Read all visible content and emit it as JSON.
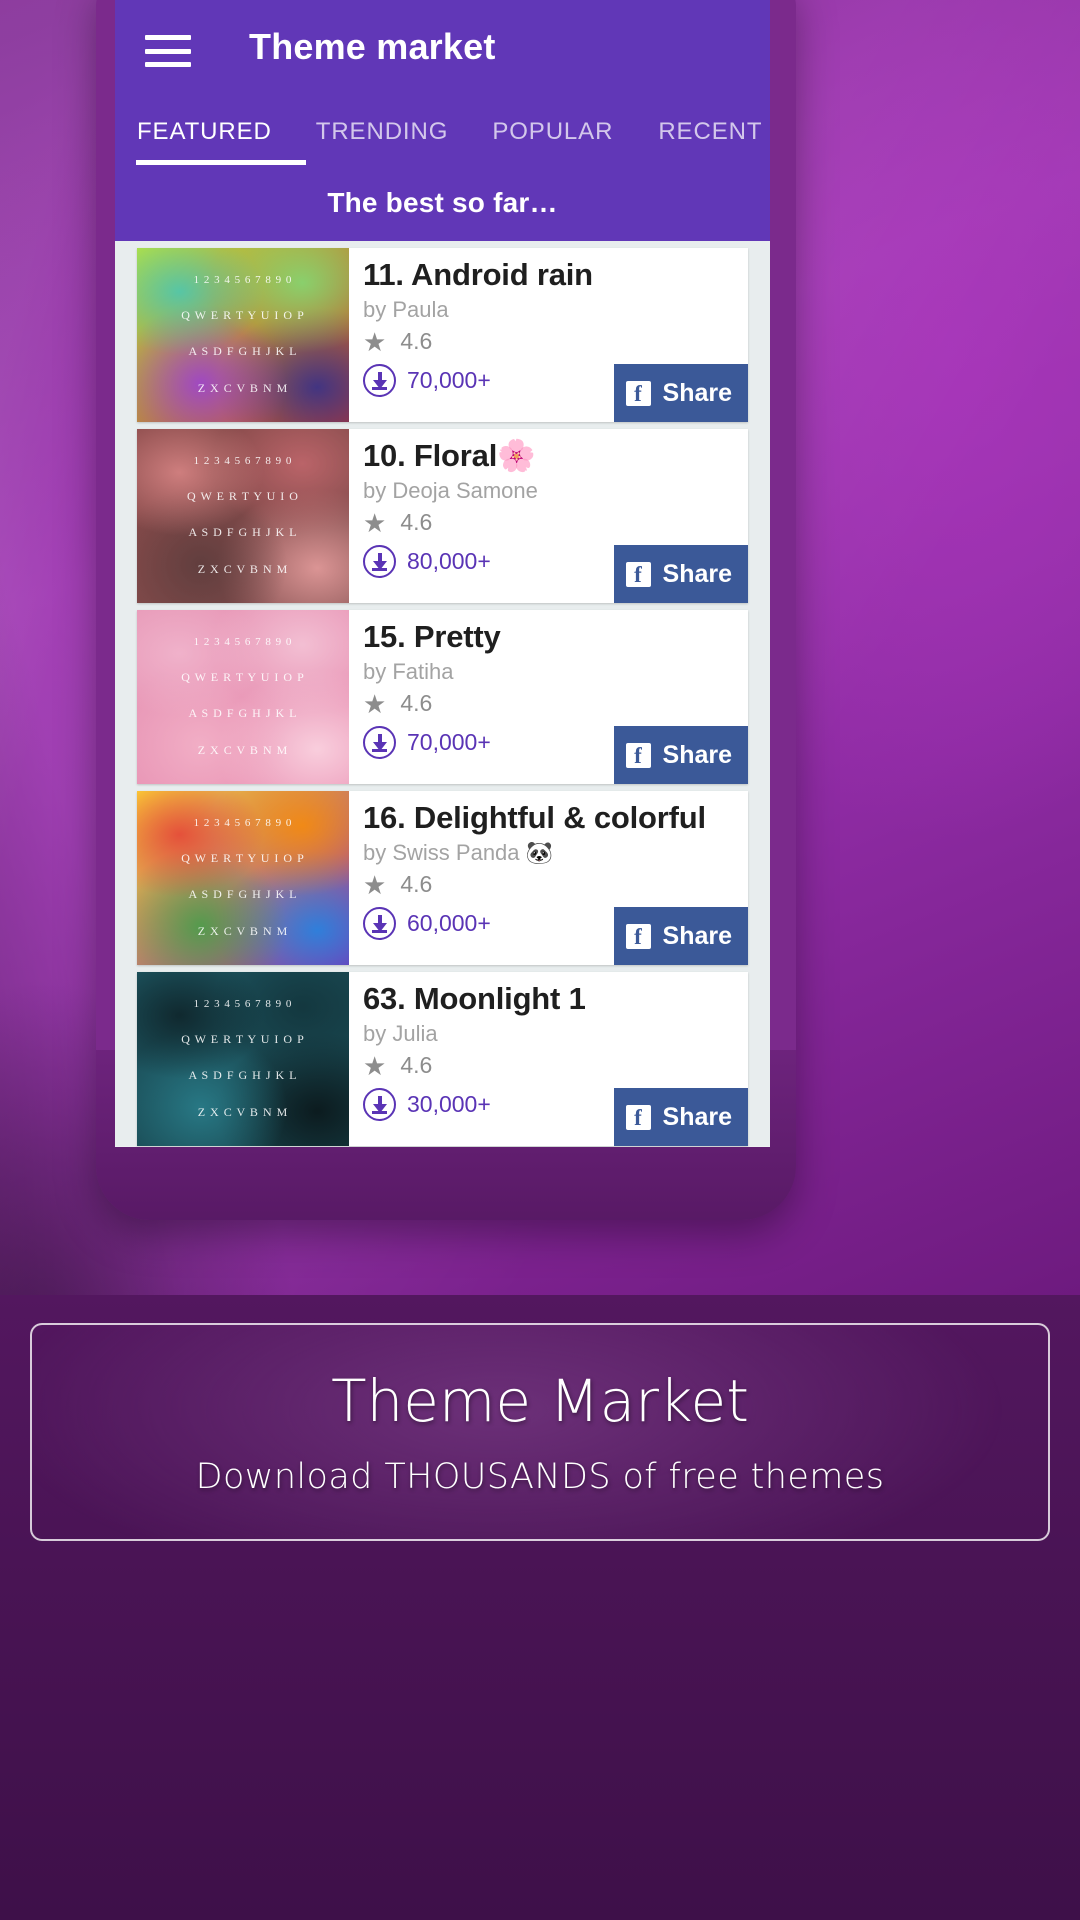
{
  "appbar": {
    "menu_icon": "hamburger-menu-icon",
    "title": "Theme market"
  },
  "tabs": [
    {
      "label": "FEATURED",
      "active": true
    },
    {
      "label": "TRENDING",
      "active": false
    },
    {
      "label": "POPULAR",
      "active": false
    },
    {
      "label": "RECENT",
      "active": false
    }
  ],
  "section": {
    "subtitle": "The best so far…"
  },
  "share": {
    "label": "Share",
    "icon": "facebook-icon",
    "glyph": "f",
    "color": "#3b5998"
  },
  "icons": {
    "star": "star-icon",
    "download": "download-circle-icon"
  },
  "themes": [
    {
      "title": "11. Android rain",
      "author": "by Paula",
      "rating": "4.6",
      "downloads": "70,000+",
      "share_label": "Share",
      "thumb_rows": [
        "1 2 3 4 5 6 7 8 9 0",
        "Q W E R T Y U I O P",
        "A S D F G H J K L",
        "Z X C V B N M"
      ],
      "thumb_colors": [
        "#3ec8c0",
        "#7de07a",
        "#b8e23f",
        "#9b3fd8",
        "#2f2f8e",
        "#c0392b"
      ]
    },
    {
      "title": "10. Floral🌸",
      "author": "by Deoja Samone",
      "rating": "4.6",
      "downloads": "80,000+",
      "share_label": "Share",
      "thumb_rows": [
        "1 2 3 4 5 6 7 8 9 0",
        "Q W E R T Y U I O",
        "A S D F G H J K L",
        "Z X C V B N M"
      ],
      "thumb_colors": [
        "#e08b8b",
        "#c86a70",
        "#8a4a4a",
        "#5c3c3c",
        "#e9a0a0",
        "#7b4b4b"
      ]
    },
    {
      "title": "15. Pretty",
      "author": "by Fatiha",
      "rating": "4.6",
      "downloads": "70,000+",
      "share_label": "Share",
      "thumb_rows": [
        "1 2 3 4 5 6 7 8 9 0",
        "Q W E R T Y U I O P",
        "A S D F G H J K L",
        "Z X C V B N M"
      ],
      "thumb_colors": [
        "#f2b8cf",
        "#f5c9da",
        "#e79ab8",
        "#f3b2c8",
        "#fbd7e3",
        "#e98fb2"
      ]
    },
    {
      "title": "16. Delightful & colorful",
      "author": "by Swiss Panda 🐼",
      "rating": "4.6",
      "downloads": "60,000+",
      "share_label": "Share",
      "thumb_rows": [
        "1 2 3 4 5 6 7 8 9 0",
        "Q W E R T Y U I O P",
        "A S D F G H J K L",
        "Z X C V B N M"
      ],
      "thumb_colors": [
        "#e53935",
        "#fb8c00",
        "#fdd835",
        "#43a047",
        "#1e88e5",
        "#8e24aa"
      ]
    },
    {
      "title": "63. Moonlight 1",
      "author": "by Julia",
      "rating": "4.6",
      "downloads": "30,000+",
      "share_label": "Share",
      "thumb_rows": [
        "1 2 3 4 5 6 7 8 9 0",
        "Q W E R T Y U I O P",
        "A S D F G H J K L",
        "Z X C V B N M"
      ],
      "thumb_colors": [
        "#0d1f24",
        "#12333a",
        "#1d5560",
        "#2a7f8c",
        "#0a1518",
        "#174048"
      ]
    }
  ],
  "promo": {
    "title": "Theme Market",
    "subtitle": "Download  THOUSANDS  of free themes"
  },
  "colors": {
    "appbar": "#6137b7",
    "accent_download": "#5a34b5",
    "facebook": "#3b5998",
    "card_bg": "#ffffff",
    "list_bg": "#e8edee"
  }
}
